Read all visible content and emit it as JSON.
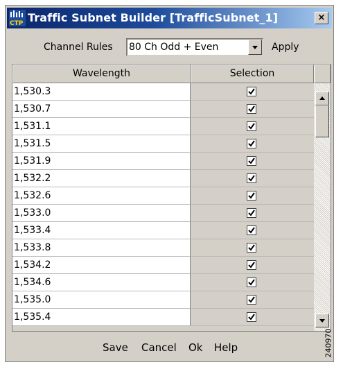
{
  "window": {
    "title": "Traffic Subnet Builder [TrafficSubnet_1]",
    "icon_label": "CTP",
    "close_label": "×"
  },
  "channel_rules": {
    "label": "Channel Rules",
    "selected": "80 Ch  Odd + Even",
    "apply_label": "Apply"
  },
  "table": {
    "columns": [
      "Wavelength",
      "Selection"
    ],
    "rows": [
      {
        "wavelength": "1,530.3",
        "selected": true
      },
      {
        "wavelength": "1,530.7",
        "selected": true
      },
      {
        "wavelength": "1,531.1",
        "selected": true
      },
      {
        "wavelength": "1,531.5",
        "selected": true
      },
      {
        "wavelength": "1,531.9",
        "selected": true
      },
      {
        "wavelength": "1,532.2",
        "selected": true
      },
      {
        "wavelength": "1,532.6",
        "selected": true
      },
      {
        "wavelength": "1,533.0",
        "selected": true
      },
      {
        "wavelength": "1,533.4",
        "selected": true
      },
      {
        "wavelength": "1,533.8",
        "selected": true
      },
      {
        "wavelength": "1,534.2",
        "selected": true
      },
      {
        "wavelength": "1,534.6",
        "selected": true
      },
      {
        "wavelength": "1,535.0",
        "selected": true
      },
      {
        "wavelength": "1,535.4",
        "selected": true
      }
    ]
  },
  "footer": {
    "save": "Save",
    "cancel": "Cancel",
    "ok": "Ok",
    "help": "Help"
  },
  "figure_code": "240970",
  "colors": {
    "title_start": "#0a246a",
    "title_end": "#a6caf0",
    "dialog_bg": "#d4d0c8"
  }
}
